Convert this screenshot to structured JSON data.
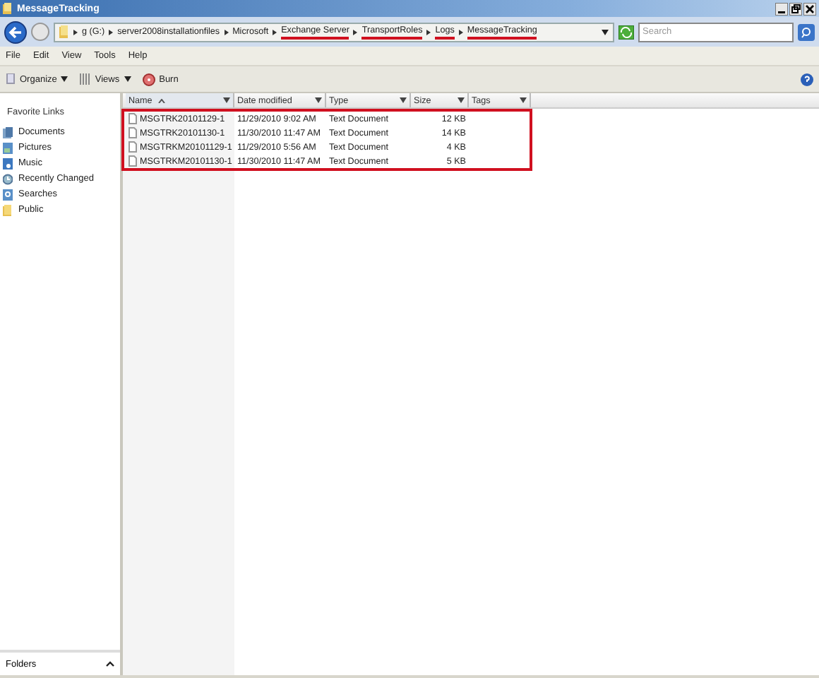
{
  "window": {
    "title": "MessageTracking"
  },
  "address_bar": {
    "path": [
      {
        "label": "g (G:)",
        "highlighted": false
      },
      {
        "label": "server2008installationfiles",
        "highlighted": false
      },
      {
        "label": "Microsoft",
        "highlighted": false
      },
      {
        "label": "Exchange Server",
        "highlighted": true
      },
      {
        "label": "TransportRoles",
        "highlighted": true
      },
      {
        "label": "Logs",
        "highlighted": true
      },
      {
        "label": "MessageTracking",
        "highlighted": true
      }
    ],
    "search": {
      "placeholder": "Search"
    }
  },
  "menu": [
    "File",
    "Edit",
    "View",
    "Tools",
    "Help"
  ],
  "toolbar": [
    {
      "label": "Organize",
      "kind": "dropdown"
    },
    {
      "label": "Views",
      "kind": "dropdown"
    },
    {
      "label": "Burn",
      "kind": "button"
    }
  ],
  "sidebar": {
    "title": "Favorite Links",
    "items": [
      {
        "label": "Documents",
        "kind": "documents"
      },
      {
        "label": "Pictures",
        "kind": "pictures"
      },
      {
        "label": "Music",
        "kind": "music"
      },
      {
        "label": "Recently Changed",
        "kind": "recent"
      },
      {
        "label": "Searches",
        "kind": "searches"
      },
      {
        "label": "Public",
        "kind": "folder"
      }
    ],
    "footer": "Folders"
  },
  "file_list": {
    "highlighted": true,
    "columns": [
      {
        "label": "Name",
        "sorted": true
      },
      {
        "label": "Date modified",
        "sorted": false
      },
      {
        "label": "Type",
        "sorted": false
      },
      {
        "label": "Size",
        "sorted": false
      },
      {
        "label": "Tags",
        "sorted": false
      }
    ],
    "rows": [
      {
        "name": "MSGTRK20101129-1",
        "date": "11/29/2010 9:02 AM",
        "type": "Text Document",
        "size": "12 KB"
      },
      {
        "name": "MSGTRK20101130-1",
        "date": "11/30/2010 11:47 AM",
        "type": "Text Document",
        "size": "14 KB"
      },
      {
        "name": "MSGTRKM20101129-1",
        "date": "11/29/2010 5:56 AM",
        "type": "Text Document",
        "size": "4 KB"
      },
      {
        "name": "MSGTRKM20101130-1",
        "date": "11/30/2010 11:47 AM",
        "type": "Text Document",
        "size": "5 KB"
      }
    ]
  }
}
